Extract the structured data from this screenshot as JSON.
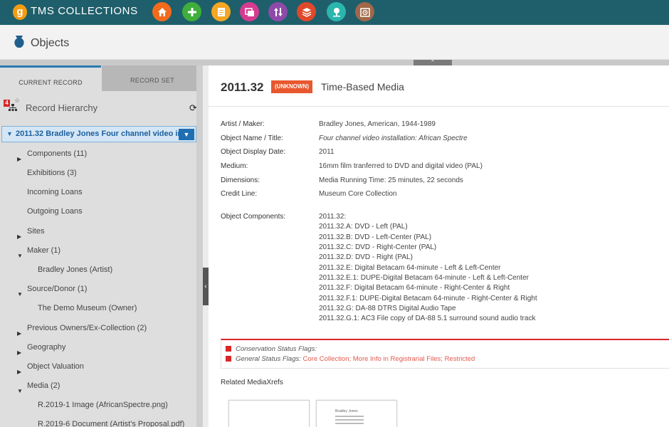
{
  "app": {
    "logo_letter": "g",
    "brand": "TMS COLLECTIONS",
    "toolbar_icons": [
      {
        "name": "home-icon",
        "color": "#f26b1d"
      },
      {
        "name": "plus-icon",
        "color": "#3fae3a"
      },
      {
        "name": "document-icon",
        "color": "#f5a623"
      },
      {
        "name": "images-icon",
        "color": "#d63b8f"
      },
      {
        "name": "transfer-icon",
        "color": "#8e4aa8"
      },
      {
        "name": "layers-icon",
        "color": "#e0482a"
      },
      {
        "name": "pin-icon",
        "color": "#2bb5ad"
      },
      {
        "name": "clock-icon",
        "color": "#a0684a"
      }
    ]
  },
  "header": {
    "title": "Objects"
  },
  "left": {
    "tabs": [
      {
        "label": "CURRENT RECORD"
      },
      {
        "label": "RECORD SET"
      }
    ],
    "hierarchy": {
      "badge": "4",
      "title": "Record Hierarchy"
    },
    "selected": {
      "label": "2011.32 Bradley Jones Four channel video in"
    },
    "tree": [
      {
        "label": "Components (11)",
        "caret": "▶"
      },
      {
        "label": "Exhibitions (3)",
        "caret": ""
      },
      {
        "label": "Incoming Loans",
        "caret": ""
      },
      {
        "label": "Outgoing Loans",
        "caret": ""
      },
      {
        "label": "Sites",
        "caret": "▶"
      },
      {
        "label": "Maker (1)",
        "caret": "▼"
      },
      {
        "label": "Bradley Jones (Artist)",
        "caret": ""
      },
      {
        "label": "Source/Donor (1)",
        "caret": "▼"
      },
      {
        "label": "The Demo Museum (Owner)",
        "caret": ""
      },
      {
        "label": "Previous Owners/Ex-Collection (2)",
        "caret": "▶"
      },
      {
        "label": "Geography",
        "caret": "▶"
      },
      {
        "label": "Object Valuation",
        "caret": "▶"
      },
      {
        "label": "Media (2)",
        "caret": "▼"
      },
      {
        "label": "R.2019-1 Image (AfricanSpectre.png)",
        "caret": ""
      },
      {
        "label": "R.2019-6 Document (Artist's Proposal.pdf)",
        "caret": ""
      }
    ]
  },
  "record": {
    "number": "2011.32",
    "status": "(UNKNOWN)",
    "classification": "Time-Based Media",
    "fields": [
      {
        "label": "Artist / Maker:",
        "value": "Bradley Jones, American, 1944-1989"
      },
      {
        "label": "Object Name / Title:",
        "value": "Four channel video installation: African Spectre"
      },
      {
        "label": "Object Display Date:",
        "value": "2011"
      },
      {
        "label": "Medium:",
        "value": "16mm film tranferred to DVD and digital video (PAL)"
      },
      {
        "label": "Dimensions:",
        "value": "Media Running Time: 25 minutes, 22 seconds"
      },
      {
        "label": "Credit Line:",
        "value": "Museum Core Collection"
      }
    ],
    "components_label": "Object Components:",
    "components": [
      "2011.32:",
      "2011.32.A: DVD - Left (PAL)",
      "2011.32.B: DVD - Left-Center (PAL)",
      "2011.32.C: DVD - Right-Center (PAL)",
      "2011.32.D: DVD - Right (PAL)",
      "2011.32.E: Digital Betacam 64-minute - Left & Left-Center",
      "2011.32.E.1: DUPE-Digital Betacam 64-minute - Left & Left-Center",
      "2011.32.F: Digital Betacam 64-minute - Right-Center & Right",
      "2011.32.F.1: DUPE-Digital Betacam 64-minute - Right-Center & Right",
      "2011.32.G: DA-88 DTRS Digital Audio Tape",
      "2011.32.G.1: AC3 File copy of DA-88 5.1 surround sound audio track"
    ],
    "flags": {
      "conservation_label": "Conservation Status Flags:",
      "general_label": "General Status Flags:",
      "general_value": "Core Collection; More Info in Registrarial Files; Restricted"
    },
    "media_title": "Related MediaXrefs",
    "thumb_text": "Bradley Jones"
  }
}
